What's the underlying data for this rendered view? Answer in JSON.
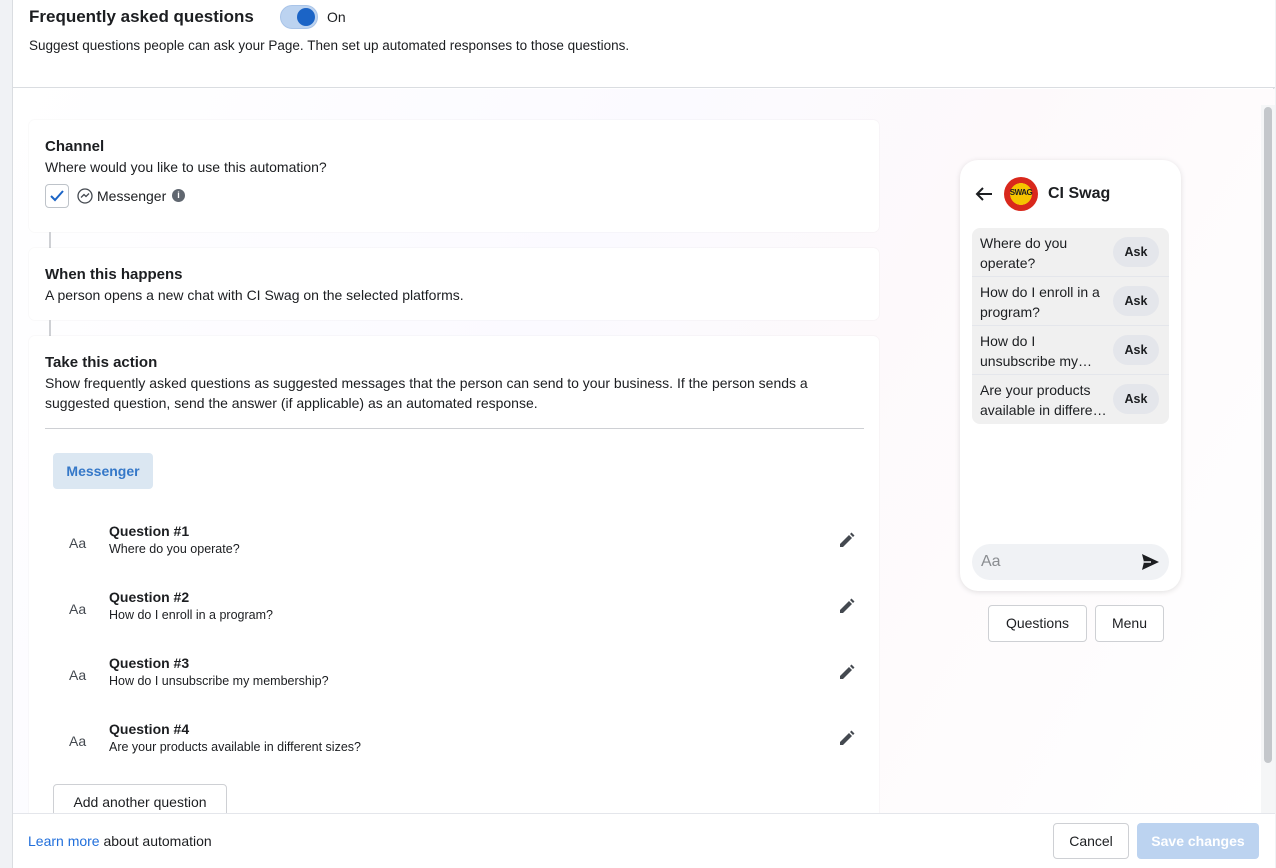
{
  "header": {
    "title": "Frequently asked questions",
    "toggle_label": "On",
    "toggle_on": true,
    "subtitle": "Suggest questions people can ask your Page. Then set up automated responses to those questions."
  },
  "channel": {
    "title": "Channel",
    "description": "Where would you like to use this automation?",
    "option_label": "Messenger",
    "checked": true
  },
  "trigger": {
    "title": "When this happens",
    "description": "A person opens a new chat with CI Swag on the selected platforms."
  },
  "action": {
    "title": "Take this action",
    "description": "Show frequently asked questions as suggested messages that the person can send to your business. If the person sends a suggested question, send the answer (if applicable) as an automated response.",
    "tab_label": "Messenger",
    "format_glyph": "Aa",
    "questions": [
      {
        "title": "Question #1",
        "text": "Where do you operate?"
      },
      {
        "title": "Question #2",
        "text": "How do I enroll in a program?"
      },
      {
        "title": "Question #3",
        "text": "How do I unsubscribe my membership?"
      },
      {
        "title": "Question #4",
        "text": "Are your products available in different sizes?"
      }
    ],
    "add_label": "Add another question"
  },
  "preview": {
    "page_name": "CI Swag",
    "avatar_text": "SWAG",
    "faq": [
      {
        "q": "Where do you operate?",
        "ask": "Ask"
      },
      {
        "q": "How do I enroll in a program?",
        "ask": "Ask"
      },
      {
        "q": "How do I unsubscribe my…",
        "ask": "Ask"
      },
      {
        "q": "Are your products available in differe…",
        "ask": "Ask"
      }
    ],
    "input_placeholder": "Aa",
    "buttons": {
      "questions": "Questions",
      "menu": "Menu"
    }
  },
  "footer": {
    "learn_link": "Learn more",
    "learn_suffix": " about automation",
    "cancel_label": "Cancel",
    "save_label": "Save changes"
  },
  "colors": {
    "accent": "#1b64c6",
    "link": "#216fdb",
    "save_disabled": "#bcd3f0",
    "tab_bg": "#dbe7f2"
  }
}
